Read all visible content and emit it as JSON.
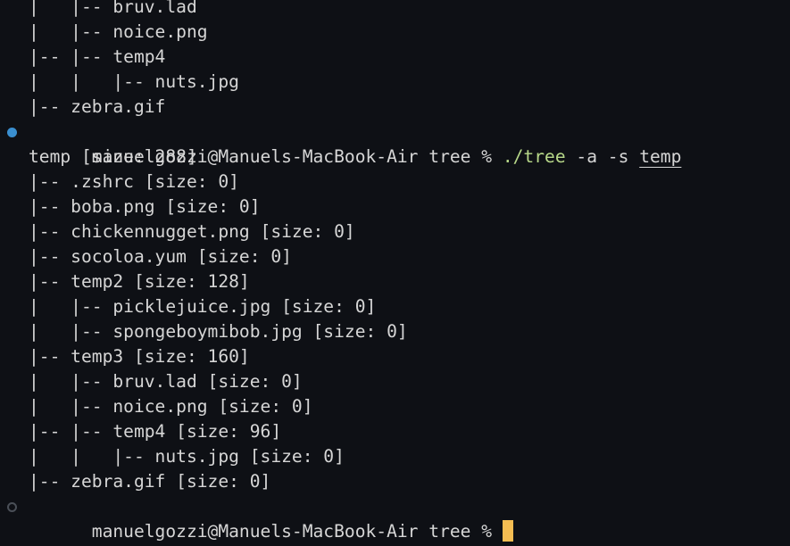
{
  "terminal": {
    "scrollback_tree_lines": [
      "|   |-- bruv.lad",
      "|   |-- noice.png",
      "|-- |-- temp4",
      "|   |   |-- nuts.jpg",
      "|-- zebra.gif"
    ],
    "previous_command": {
      "prompt": "manuelgozzi@Manuels-MacBook-Air tree % ",
      "binary": "./tree",
      "flags": " -a -s ",
      "path_arg": "temp",
      "status_decoration": "success-dot",
      "status_color": "#3a8fd0"
    },
    "output_lines": [
      "temp [size: 288]",
      "|-- .zshrc [size: 0]",
      "|-- boba.png [size: 0]",
      "|-- chickennugget.png [size: 0]",
      "|-- socoloa.yum [size: 0]",
      "|-- temp2 [size: 128]",
      "|   |-- picklejuice.jpg [size: 0]",
      "|   |-- spongeboymibob.jpg [size: 0]",
      "|-- temp3 [size: 160]",
      "|   |-- bruv.lad [size: 0]",
      "|   |-- noice.png [size: 0]",
      "|-- |-- temp4 [size: 96]",
      "|   |   |-- nuts.jpg [size: 0]",
      "|-- zebra.gif [size: 0]"
    ],
    "current_prompt": {
      "prompt": "manuelgozzi@Manuels-MacBook-Air tree % ",
      "input_value": "",
      "status_decoration": "pending-circle",
      "cursor_color": "#f5bd52"
    },
    "colors": {
      "background": "#0e1015",
      "foreground": "#d6d6d6",
      "command_binary": "#b8d98a"
    }
  }
}
